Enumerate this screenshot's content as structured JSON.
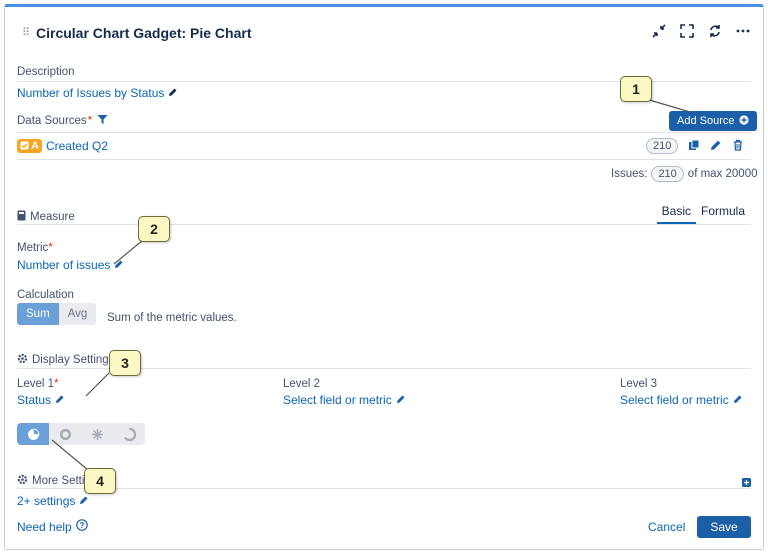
{
  "header": {
    "title": "Circular Chart Gadget: Pie Chart",
    "icons": [
      "collapse-icon",
      "expand-icon",
      "refresh-icon",
      "more-icon"
    ]
  },
  "description": {
    "label": "Description",
    "value": "Number of Issues by Status"
  },
  "data_sources": {
    "label": "Data Sources",
    "required_mark": "*",
    "add_button": "Add Source",
    "source": {
      "letter": "A",
      "name": "Created Q2",
      "count": "210"
    },
    "issues_label": "Issues:",
    "issues_count": "210",
    "issues_max": "of max 20000"
  },
  "measure": {
    "label": "Measure",
    "tabs": [
      "Basic",
      "Formula"
    ],
    "active_tab": "Basic",
    "metric_label": "Metric",
    "metric_required": "*",
    "metric_value": "Number of issues",
    "calculation_label": "Calculation",
    "calc_options": [
      "Sum",
      "Avg"
    ],
    "calc_selected": "Sum",
    "calc_description": "Sum of the metric values."
  },
  "display": {
    "label": "Display Settings",
    "level1_label": "Level 1",
    "level1_required": "*",
    "level1_value": "Status",
    "level2_label": "Level 2",
    "level2_value": "Select field or metric",
    "level3_label": "Level 3",
    "level3_value": "Select field or metric",
    "chart_types": [
      "pie-chart-icon",
      "donut-chart-icon",
      "sunburst-chart-icon",
      "spiral-chart-icon"
    ],
    "chart_type_selected": 0
  },
  "more": {
    "label": "More Settings",
    "value": "2+ settings"
  },
  "footer": {
    "help": "Need help",
    "cancel": "Cancel",
    "save": "Save"
  },
  "callouts": [
    "1",
    "2",
    "3",
    "4"
  ],
  "colors": {
    "accent": "#1b5fa8",
    "link": "#0c66b5",
    "source_badge": "#f5a623",
    "callout_bg": "#fcf8c4"
  }
}
